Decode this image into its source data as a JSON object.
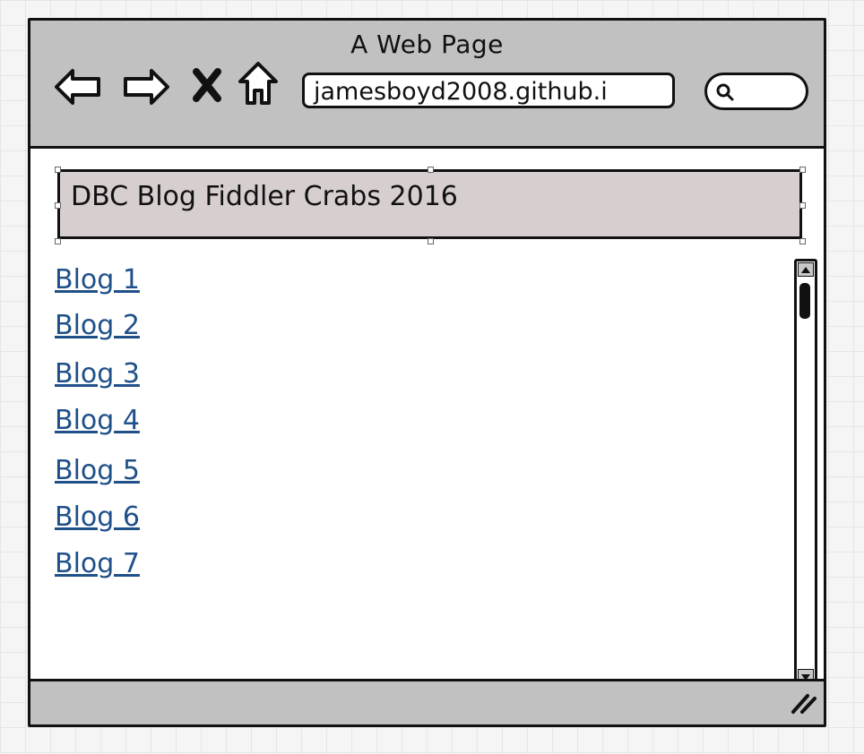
{
  "window": {
    "title": "A Web Page",
    "url": "jamesboyd2008.github.i"
  },
  "nav": {
    "icons": [
      "back-arrow-icon",
      "forward-arrow-icon",
      "close-x-icon",
      "home-icon"
    ]
  },
  "search": {
    "icon": "magnifier-icon"
  },
  "header": {
    "title": "DBC Blog Fiddler Crabs 2016"
  },
  "links": [
    {
      "label": "Blog 1"
    },
    {
      "label": "Blog 2"
    },
    {
      "label": "Blog 3"
    },
    {
      "label": "Blog 4"
    },
    {
      "label": "Blog 5"
    },
    {
      "label": "Blog 6"
    },
    {
      "label": "Blog 7"
    }
  ],
  "colors": {
    "chrome": "#c1c1c1",
    "header_bg": "#d7cfcf",
    "link": "#1f5089"
  }
}
